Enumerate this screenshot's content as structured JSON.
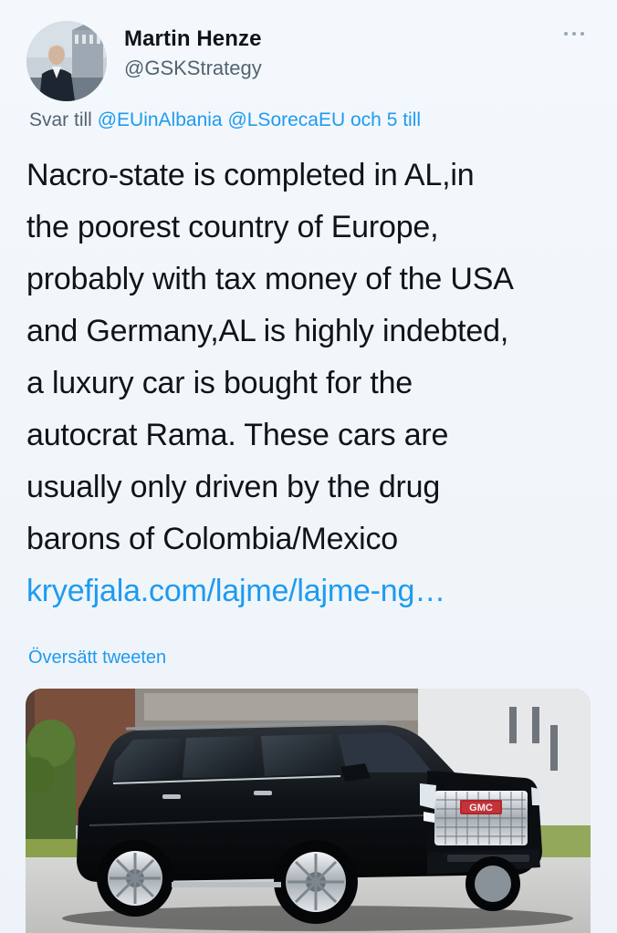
{
  "author": {
    "name": "Martin Henze",
    "handle": "@GSKStrategy"
  },
  "reply": {
    "prefix": "Svar till",
    "mentions": [
      "@EUinAlbania",
      "@LSorecaEU"
    ],
    "suffix": "och 5 till"
  },
  "tweet": {
    "lines": [
      "Nacro-state is completed in AL,in",
      "the poorest country of Europe,",
      "probably with tax money of the USA",
      "and Germany,AL is highly indebted,",
      "a luxury car is bought for the",
      "autocrat Rama. These cars are",
      "usually only driven by the drug",
      "barons of Colombia/Mexico"
    ],
    "link": "kryefjala.com/lajme/lajme-ng…"
  },
  "translate_label": "Översätt tweeten",
  "media": {
    "grille_badge": "GMC",
    "subject": "black GMC Yukon SUV"
  },
  "icons": {
    "more": "more-icon"
  },
  "colors": {
    "link": "#1d9bf0",
    "secondary_text": "#536471",
    "primary_text": "#0f1419",
    "background": "#eef3f8"
  }
}
